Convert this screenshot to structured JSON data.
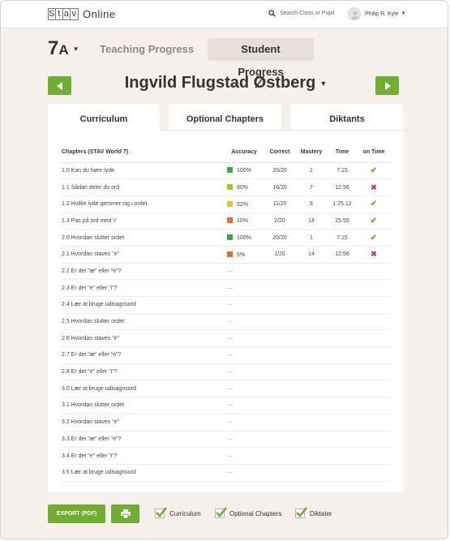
{
  "header": {
    "logo_letters": [
      "S",
      "t",
      "a",
      "v"
    ],
    "logo_text": "Online",
    "search_placeholder": "Search Class or Pupil",
    "user_name": "Philip R. Kyle"
  },
  "nav": {
    "class_number": "7",
    "class_letter": "A",
    "teaching_label": "Teaching Progress",
    "student_label": "Student Progress"
  },
  "pupil": {
    "name": "Ingvild Flugstad Østberg"
  },
  "tabs": [
    "Curriculum",
    "Optional Chapters",
    "Diktants"
  ],
  "table": {
    "headers": [
      "Chapters (STAV World 7)",
      "Accuracy",
      "Correct",
      "Mastery",
      "Time",
      "on Time"
    ],
    "rows": [
      {
        "chapter": "1.0 Kan du høre lyde",
        "accuracy": "100%",
        "color": "#3aaa48",
        "correct": "20/20",
        "mastery": "1",
        "time": "7:15",
        "on_time": "yes"
      },
      {
        "chapter": "1.1 Sådan deler du ord",
        "accuracy": "80%",
        "color": "#b6bd1f",
        "correct": "16/20",
        "mastery": "7",
        "time": "12:56",
        "on_time": "no"
      },
      {
        "chapter": "1.2 Hvilke lyde gemmer sig i ordet",
        "accuracy": "52%",
        "color": "#e3c71e",
        "correct": "11/20",
        "mastery": "8",
        "time": "1:25:12",
        "on_time": "yes"
      },
      {
        "chapter": "1.3 Pas på ord med 'r'",
        "accuracy": "10%",
        "color": "#ec6a24",
        "correct": "2/20",
        "mastery": "14",
        "time": "25:55",
        "on_time": "yes"
      },
      {
        "chapter": "2.0 Hvordan slutter ordet",
        "accuracy": "100%",
        "color": "#3aaa48",
        "correct": "20/20",
        "mastery": "1",
        "time": "7:15",
        "on_time": "yes"
      },
      {
        "chapter": "2.1 Hvordan staves \"e\"",
        "accuracy": "5%",
        "color": "#ec6a24",
        "correct": "1/20",
        "mastery": "14",
        "time": "12:56",
        "on_time": "no"
      },
      {
        "chapter": "2.2 Er det \"æ\" eller \"e\"?",
        "accuracy": "—"
      },
      {
        "chapter": "2.3 Er det \"e\" eller \"i\"?",
        "accuracy": "—"
      },
      {
        "chapter": "2.4 Lær at bruge udisagnsord",
        "accuracy": "—"
      },
      {
        "chapter": "2.5 Hvordan slutter ordet",
        "accuracy": "—"
      },
      {
        "chapter": "2.6 Hvordan staves \"e\"",
        "accuracy": "—"
      },
      {
        "chapter": "2.7 Er det \"æ\" eller \"e\"?",
        "accuracy": "—"
      },
      {
        "chapter": "2.8 Er det \"e\" eller \"i\"?",
        "accuracy": "—"
      },
      {
        "chapter": "3.0 Lær at bruge udisagnsord",
        "accuracy": "—"
      },
      {
        "chapter": "3.1 Hvordan slutter ordet",
        "accuracy": "—"
      },
      {
        "chapter": "3.2 Hvordan staves \"e\"",
        "accuracy": "—"
      },
      {
        "chapter": "3.3 Er det \"æ\" eller \"e\"?",
        "accuracy": "—"
      },
      {
        "chapter": "3.4 Er det \"e\" eller \"i\"?",
        "accuracy": "—"
      },
      {
        "chapter": "3.5 Lær at bruge udisagnsord",
        "accuracy": "—"
      }
    ]
  },
  "footer": {
    "export_label": "EXPORT (PDF)",
    "checkboxes": [
      "Curriculum",
      "Optional Chapters",
      "Diktater"
    ]
  },
  "colors": {
    "accent": "#6fae30",
    "background": "#f5f0eb"
  }
}
